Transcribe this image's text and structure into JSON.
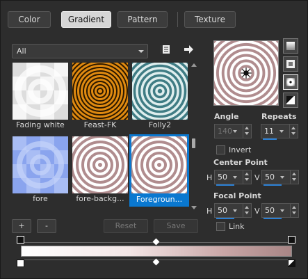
{
  "tabs": [
    {
      "label": "Color",
      "active": false
    },
    {
      "label": "Gradient",
      "active": true
    },
    {
      "label": "Pattern",
      "active": false
    },
    {
      "label": "Texture",
      "active": false
    }
  ],
  "category": {
    "selected": "All"
  },
  "icons": {
    "library": "book-icon",
    "more": "arrow-right-icon"
  },
  "thumbnails": [
    {
      "label": "Fading white",
      "style": "fading-white",
      "selected": false
    },
    {
      "label": "Feast-FK",
      "style": "feast",
      "selected": false
    },
    {
      "label": "Folly2",
      "style": "folly",
      "selected": false
    },
    {
      "label": "fore",
      "style": "fore",
      "selected": false
    },
    {
      "label": "fore-backg...",
      "style": "fore-back",
      "selected": false
    },
    {
      "label": "Foregroun...",
      "style": "foreground",
      "selected": true
    }
  ],
  "angle": {
    "label": "Angle",
    "value": "140",
    "disabled": true
  },
  "repeats": {
    "label": "Repeats",
    "value": "11"
  },
  "invert": {
    "label": "Invert",
    "checked": false
  },
  "center_point": {
    "label": "Center Point",
    "h_label": "H",
    "h_value": "50",
    "v_label": "V",
    "v_value": "50"
  },
  "focal_point": {
    "label": "Focal Point",
    "h_label": "H",
    "h_value": "50",
    "v_label": "V",
    "v_value": "50"
  },
  "link": {
    "label": "Link",
    "checked": false
  },
  "buttons": {
    "add": "+",
    "remove": "-",
    "reset": "Reset",
    "save": "Save"
  },
  "colors": {
    "accent": "#0a78d0",
    "ring_dark": "#b08c8e",
    "ring_light": "#ffffff"
  }
}
